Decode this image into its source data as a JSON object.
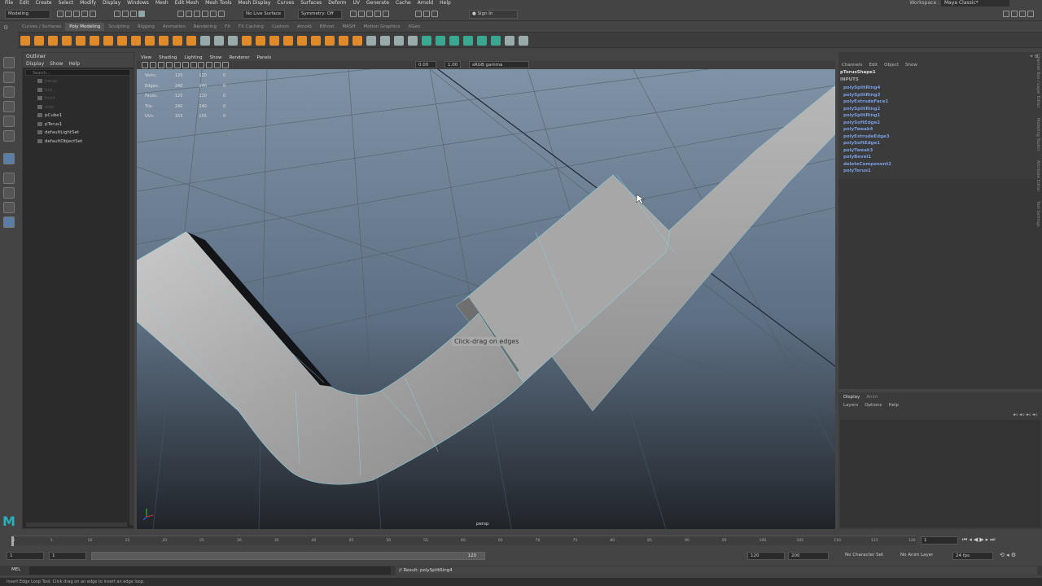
{
  "menubar": {
    "items": [
      "File",
      "Edit",
      "Create",
      "Select",
      "Modify",
      "Display",
      "Windows",
      "Mesh",
      "Edit Mesh",
      "Mesh Tools",
      "Mesh Display",
      "Curves",
      "Surfaces",
      "Deform",
      "UV",
      "Generate",
      "Cache",
      "Arnold",
      "Help"
    ],
    "workspace_label": "Workspace :",
    "workspace_value": "Maya Classic*"
  },
  "statusline": {
    "mode": "Modeling",
    "live_surface": "No Live Surface",
    "symmetry": "Symmetry: Off",
    "sign_in": "Sign In"
  },
  "shelf": {
    "tabs": [
      "Curves / Surfaces",
      "Poly Modeling",
      "Sculpting",
      "Rigging",
      "Animation",
      "Rendering",
      "FX",
      "FX Caching",
      "Custom",
      "Arnold",
      "Bifrost",
      "MASH",
      "Motion Graphics",
      "XGen"
    ],
    "active_tab": "Poly Modeling",
    "icon_colors": [
      "#e08a2a",
      "#e08a2a",
      "#e08a2a",
      "#e08a2a",
      "#e08a2a",
      "#e08a2a",
      "#e08a2a",
      "#e08a2a",
      "#e08a2a",
      "#e08a2a",
      "#e08a2a",
      "#e08a2a",
      "#e08a2a",
      "#9aa",
      "#9aa",
      "#9aa",
      "#e08a2a",
      "#e08a2a",
      "#e08a2a",
      "#e08a2a",
      "#e08a2a",
      "#e08a2a",
      "#e08a2a",
      "#e08a2a",
      "#e08a2a",
      "#9aa",
      "#9aa",
      "#9aa",
      "#9aa",
      "#3aa890",
      "#3aa890",
      "#3aa890",
      "#3aa890",
      "#3aa890",
      "#3aa890",
      "#9aa",
      "#9aa"
    ]
  },
  "outliner": {
    "title": "Outliner",
    "menus": [
      "Display",
      "Show",
      "Help"
    ],
    "search_placeholder": "Search...",
    "items": [
      {
        "label": "persp",
        "dim": true
      },
      {
        "label": "top",
        "dim": true
      },
      {
        "label": "front",
        "dim": true
      },
      {
        "label": "side",
        "dim": true
      },
      {
        "label": "pCube1",
        "dim": false
      },
      {
        "label": "pTorus1",
        "dim": false
      },
      {
        "label": "defaultLightSet",
        "dim": false
      },
      {
        "label": "defaultObjectSet",
        "dim": false
      }
    ]
  },
  "viewport": {
    "menus": [
      "View",
      "Shading",
      "Lighting",
      "Show",
      "Renderer",
      "Panels"
    ],
    "exposure": "0.00",
    "gamma": "1.00",
    "color_space": "sRGB gamma",
    "camera_label": "persp",
    "tooltip": "Click-drag on edges",
    "hud": [
      {
        "label": "Verts:",
        "a": "120",
        "b": "120",
        "c": "0"
      },
      {
        "label": "Edges:",
        "a": "240",
        "b": "240",
        "c": "0"
      },
      {
        "label": "Faces:",
        "a": "120",
        "b": "120",
        "c": "0"
      },
      {
        "label": "Tris:",
        "a": "240",
        "b": "240",
        "c": "0"
      },
      {
        "label": "UVs:",
        "a": "155",
        "b": "155",
        "c": "0"
      }
    ]
  },
  "channels": {
    "menus": [
      "Channels",
      "Edit",
      "Object",
      "Show"
    ],
    "object": "pTorusShape1",
    "inputs_label": "INPUTS",
    "inputs": [
      "polySplitRing4",
      "polySplitRing3",
      "polyExtrudeFace1",
      "polySplitRing2",
      "polySplitRing1",
      "polySoftEdge2",
      "polyTweak4",
      "polyExtrudeEdge3",
      "polySoftEdge1",
      "polyTweak3",
      "polyBevel1",
      "deleteComponent2",
      "polyTorus1"
    ],
    "side_tabs": [
      "Channel Box / Layer Editor",
      "Modeling Toolkit",
      "Attribute Editor",
      "Tool Settings"
    ]
  },
  "layers": {
    "tabs": [
      "Display",
      "Anim"
    ],
    "menus": [
      "Layers",
      "Options",
      "Help"
    ]
  },
  "timeline": {
    "ticks": [
      "1",
      "5",
      "10",
      "15",
      "20",
      "25",
      "30",
      "35",
      "40",
      "45",
      "50",
      "55",
      "60",
      "65",
      "70",
      "75",
      "80",
      "85",
      "90",
      "95",
      "100",
      "105",
      "110",
      "115",
      "120"
    ],
    "current_frame": "1"
  },
  "range": {
    "start": "1",
    "inner_start": "1",
    "inner_end": "120",
    "anim_end": "120",
    "end": "200",
    "character_set": "No Character Set",
    "anim_layer": "No Anim Layer",
    "fps": "24 fps"
  },
  "cmdline": {
    "lang": "MEL",
    "result": "// Result: polySplitRing4"
  },
  "helpline": {
    "text": "Insert Edge Loop Tool: Click drag on an edge to insert an edge loop."
  }
}
